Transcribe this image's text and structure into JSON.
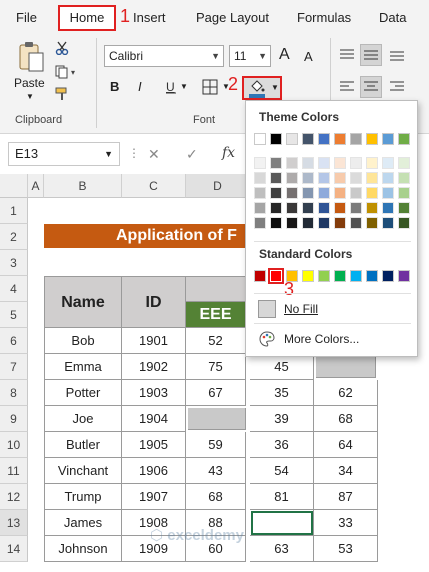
{
  "menu": {
    "file": "File",
    "home": "Home",
    "insert": "Insert",
    "page_layout": "Page Layout",
    "formulas": "Formulas",
    "data": "Data"
  },
  "steps": {
    "s1": "1",
    "s2": "2",
    "s3": "3"
  },
  "ribbon": {
    "paste_label": "Paste",
    "clipboard_label": "Clipboard",
    "font_label": "Font",
    "font_name": "Calibri",
    "font_size": "11",
    "grow_font": "A",
    "shrink_font": "A",
    "bold": "B",
    "italic": "I"
  },
  "formula_bar": {
    "name_box": "E13",
    "fx": "fx",
    "cancel": "✕",
    "enter": "✓"
  },
  "columns": [
    "A",
    "B",
    "C",
    "D"
  ],
  "rows": [
    "1",
    "2",
    "3",
    "4",
    "5",
    "6",
    "7",
    "8",
    "9",
    "10",
    "11",
    "12",
    "13",
    "14"
  ],
  "sheet": {
    "title": "Application of F",
    "header_name": "Name",
    "header_id": "ID",
    "header_eee": "EEE",
    "records": [
      {
        "name": "Bob",
        "id": "1901",
        "d": "52",
        "e": "",
        "f": ""
      },
      {
        "name": "Emma",
        "id": "1902",
        "d": "75",
        "e": "45",
        "f": ""
      },
      {
        "name": "Potter",
        "id": "1903",
        "d": "67",
        "e": "35",
        "f": "62"
      },
      {
        "name": "Joe",
        "id": "1904",
        "d": "",
        "e": "39",
        "f": "68"
      },
      {
        "name": "Butler",
        "id": "1905",
        "d": "59",
        "e": "36",
        "f": "64"
      },
      {
        "name": "Vinchant",
        "id": "1906",
        "d": "43",
        "e": "54",
        "f": "34"
      },
      {
        "name": "Trump",
        "id": "1907",
        "d": "68",
        "e": "81",
        "f": "87"
      },
      {
        "name": "James",
        "id": "1908",
        "d": "88",
        "e": "",
        "f": "33"
      },
      {
        "name": "Johnson",
        "id": "1909",
        "d": "60",
        "e": "63",
        "f": "53"
      }
    ]
  },
  "color_menu": {
    "theme_title": "Theme Colors",
    "standard_title": "Standard Colors",
    "no_fill": "No Fill",
    "more_colors": "More Colors...",
    "theme_top": [
      "#ffffff",
      "#000000",
      "#e7e6e6",
      "#44546a",
      "#4472c4",
      "#ed7d31",
      "#a5a5a5",
      "#ffc000",
      "#5b9bd5",
      "#70ad47"
    ],
    "theme_shades": [
      [
        "#f2f2f2",
        "#7f7f7f",
        "#d0cece",
        "#d6dce4",
        "#d9e2f3",
        "#fbe5d5",
        "#ededed",
        "#fff2cc",
        "#deebf6",
        "#e2efd9"
      ],
      [
        "#d8d8d8",
        "#595959",
        "#aeabab",
        "#adb9ca",
        "#b4c6e7",
        "#f7cbac",
        "#dbdbdb",
        "#fee599",
        "#bdd7ee",
        "#c5e0b3"
      ],
      [
        "#bfbfbf",
        "#3f3f3f",
        "#757070",
        "#8496b0",
        "#8eaadb",
        "#f4b183",
        "#c9c9c9",
        "#ffd965",
        "#9cc3e5",
        "#a8d08d"
      ],
      [
        "#a5a5a5",
        "#262626",
        "#3a3838",
        "#323f4f",
        "#2f5496",
        "#c55a11",
        "#7b7b7b",
        "#bf9000",
        "#2e75b5",
        "#538135"
      ],
      [
        "#7f7f7f",
        "#0c0c0c",
        "#171616",
        "#222a35",
        "#1f3864",
        "#833c0b",
        "#525252",
        "#7f6000",
        "#1e4e79",
        "#375623"
      ]
    ],
    "standard": [
      "#c00000",
      "#ff0000",
      "#ffc000",
      "#ffff00",
      "#92d050",
      "#00b050",
      "#00b0f0",
      "#0070c0",
      "#002060",
      "#7030a0"
    ]
  },
  "colors": {
    "title_fill": "#c55a11",
    "eee_fill": "#548235",
    "header_fill": "#d0cece",
    "gray_cell": "#c9c9c9",
    "accent_red": "#e02020"
  }
}
